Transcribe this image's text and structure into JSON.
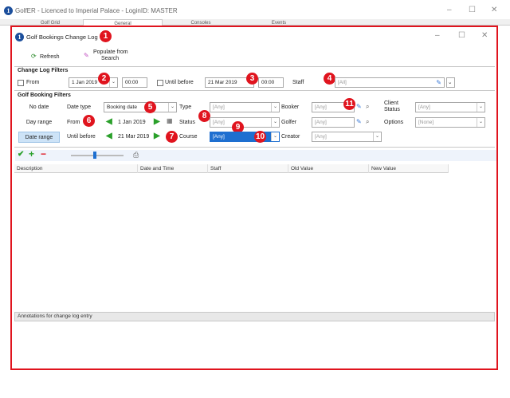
{
  "app": {
    "title": "GolfER - Licenced to Imperial Palace - LoginID: MASTER",
    "logo_letter": "1",
    "tabs": [
      "Golf Grid",
      "General",
      "Consoles",
      "Events"
    ],
    "controls": {
      "minimize": "–",
      "maximize": "☐",
      "close": "✕"
    }
  },
  "dialog": {
    "title": "Golf Bookings Change Log",
    "logo_letter": "1",
    "controls": {
      "minimize": "–",
      "maximize": "☐",
      "close": "✕"
    },
    "toolbar": {
      "refresh": "Refresh",
      "populate_line1": "Populate from",
      "populate_line2": "Search"
    },
    "change_log_filters": {
      "heading": "Change Log Filters",
      "from_label": "From",
      "from_date": "1 Jan 2019",
      "from_time": "00:00",
      "until_label": "Until before",
      "until_date": "21 Mar 2019",
      "until_time": "00:00",
      "staff_label": "Staff",
      "staff_value": "[All]"
    },
    "golf_booking_filters": {
      "heading": "Golf Booking Filters",
      "left_buttons": [
        "No date",
        "Day range",
        "Date range"
      ],
      "date_type_label": "Date type",
      "date_type_value": "Booking date",
      "from_label": "From",
      "from_value": "1 Jan 2019",
      "until_label": "Until before",
      "until_value": "21 Mar 2019",
      "type_label": "Type",
      "type_value": "[Any]",
      "status_label": "Status",
      "status_value": "[Any]",
      "course_label": "Course",
      "course_value": "[Any]",
      "booker_label": "Booker",
      "booker_value": "[Any]",
      "golfer_label": "Golfer",
      "golfer_value": "[Any]",
      "creator_label": "Creator",
      "creator_value": "[Any]",
      "client_status_label_1": "Client",
      "client_status_label_2": "Status",
      "client_status_value": "[Any]",
      "options_label": "Options",
      "options_value": "[None]"
    },
    "grid": {
      "columns": [
        "Description",
        "Date and Time",
        "Staff",
        "Old Value",
        "New Value"
      ]
    },
    "annotations_label": "Annotations for change log entry"
  },
  "badges": [
    "1",
    "2",
    "3",
    "4",
    "5",
    "6",
    "7",
    "8",
    "9",
    "10",
    "11"
  ],
  "colors": {
    "badge": "#e0141e",
    "border": "#e0141e",
    "accent": "#1c4f9c",
    "selected": "#cde3f7",
    "arrow": "#2aa02a"
  }
}
